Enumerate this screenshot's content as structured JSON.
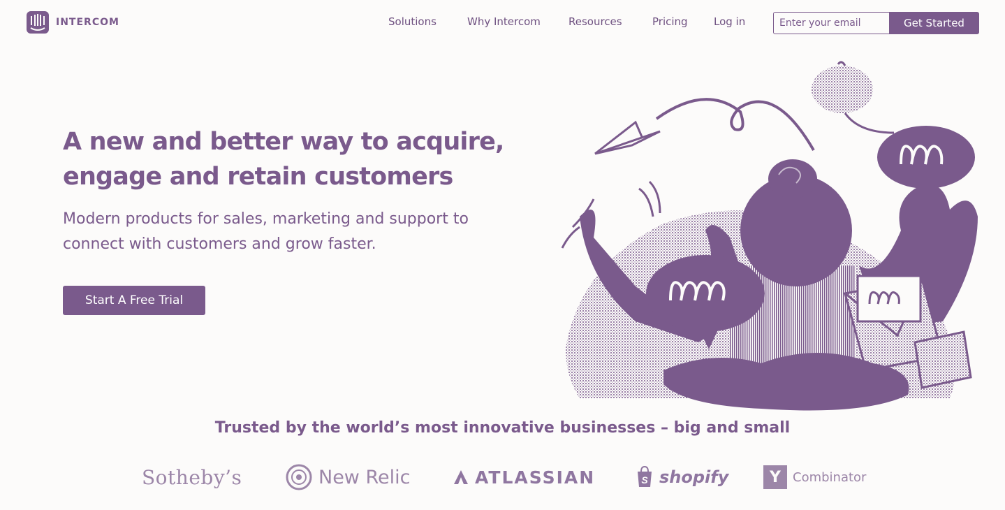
{
  "brand": {
    "name": "INTERCOM"
  },
  "nav": {
    "items": [
      {
        "label": "Solutions"
      },
      {
        "label": "Why Intercom"
      },
      {
        "label": "Resources"
      },
      {
        "label": "Pricing"
      },
      {
        "label": "Log in"
      }
    ]
  },
  "signup": {
    "email_placeholder": "Enter your email",
    "button_label": "Get Started"
  },
  "hero": {
    "headline_line1": "A new and better way to acquire,",
    "headline_line2": "engage and retain customers",
    "subhead_line1": "Modern products for sales, marketing and support to",
    "subhead_line2": "connect with customers and grow faster.",
    "cta_label": "Start A Free Trial"
  },
  "trusted": {
    "heading": "Trusted by the world’s most innovative businesses – big and small",
    "logos": [
      "Sotheby’s",
      "New Relic",
      "ATLASSIAN",
      "shopify",
      "Combinator"
    ]
  },
  "colors": {
    "accent": "#7a5a8c",
    "background": "#fcfbfa",
    "logo_muted": "#9c86a8"
  },
  "icons": [
    "intercom-logo-icon",
    "paper-plane-icon",
    "new-relic-icon",
    "atlassian-icon",
    "shopify-bag-icon",
    "y-combinator-icon"
  ]
}
